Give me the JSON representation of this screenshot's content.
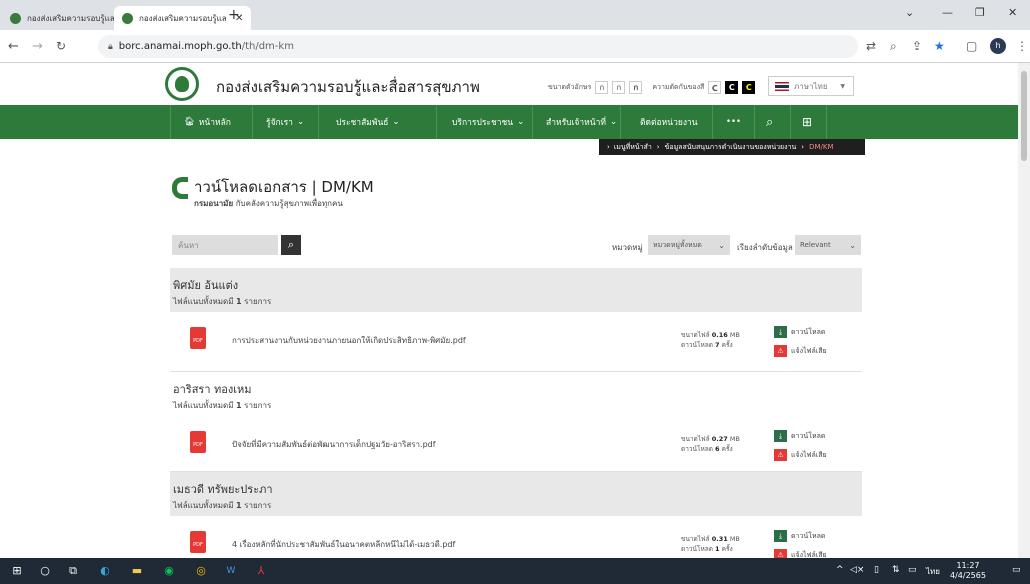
{
  "browser": {
    "tabs": [
      {
        "title": "กองส่งเสริมความรอบรู้และสื่อสารสุขภาพ",
        "active": false
      },
      {
        "title": "กองส่งเสริมความรอบรู้และสื่อสารสุขภาพ",
        "active": true
      }
    ],
    "url_host": "borc.anamai.moph.go.th",
    "url_path": "/th/dm-km",
    "profile_initial": "h"
  },
  "header": {
    "site_title": "กองส่งเสริมความรอบรู้และสื่อสารสุขภาพ",
    "font_size_label": "ขนาดตัวอักษร",
    "font_sizes": [
      "ก",
      "ก",
      "ก"
    ],
    "contrast_label": "ความตัดกันของสี",
    "contrast_options": [
      "C",
      "C",
      "C"
    ],
    "language": "ภาษาไทย"
  },
  "nav": {
    "items": [
      "หน้าหลัก",
      "รู้จักเรา",
      "ประชาสัมพันธ์",
      "บริการประชาชน",
      "สำหรับเจ้าหน้าที่",
      "ติดต่อหน่วยงาน",
      "•••"
    ]
  },
  "breadcrumb": {
    "items": [
      "เมนูที่หน้าสำ",
      "ข้อมูลสนับสนุนการดำเนินงานของหน่วยงาน",
      "DM/KM"
    ]
  },
  "heading": {
    "title": "าวน์โหลดเอกสาร | DM/KM",
    "subtitle_bold": "กรมอนามัย",
    "subtitle": "กับคลังความรู้สุขภาพเพื่อทุกคน"
  },
  "filters": {
    "search_placeholder": "ค้นหา",
    "category_label": "หมวดหมู่",
    "category_value": "หมวดหมู่ทั้งหมด",
    "sort_label": "เรียงลำดับข้อมูล",
    "sort_value": "Relevant"
  },
  "labels": {
    "size_label": "ขนาดไฟล์",
    "size_unit": "MB",
    "downloads_label": "ดาวน์โหลด",
    "downloads_unit": "ครั้ง",
    "download_action": "ดาวน์โหลด",
    "report_action": "แจ้งไฟล์เสีย",
    "pdf_tag": "PDF"
  },
  "groups": [
    {
      "author": "พิศมัย อ้นแต่ง",
      "count_text": "ไฟล์แนบทั้งหมดมี",
      "count": "1",
      "count_unit": "รายการ",
      "file": {
        "name": "การประสานงานกับหน่วยงานภายนอกให้เกิดประสิทธิภาพ-พิศมัย.pdf",
        "size": "0.16",
        "downloads": "7"
      }
    },
    {
      "author": "อาริสรา ทองเหม",
      "count_text": "ไฟล์แนบทั้งหมดมี",
      "count": "1",
      "count_unit": "รายการ",
      "file": {
        "name": "ปัจจัยที่มีความสัมพันธ์ต่อพัฒนาการเด็กปฐมวัย-อาริสรา.pdf",
        "size": "0.27",
        "downloads": "6"
      }
    },
    {
      "author": "เมธวดี ทรัพยะประภา",
      "count_text": "ไฟล์แนบทั้งหมดมี",
      "count": "1",
      "count_unit": "รายการ",
      "file": {
        "name": "4 เรื่องหลักที่นักประชาสัมพันธ์ในอนาคตหลีกหนีไม่ได้-เมธวดี.pdf",
        "size": "0.31",
        "downloads": "1"
      }
    }
  ],
  "taskbar": {
    "time": "11:27",
    "date": "4/4/2565",
    "lang": "ไทย"
  },
  "colors": {
    "brand_green": "#2d7a3b",
    "pdf_red": "#e53935"
  }
}
